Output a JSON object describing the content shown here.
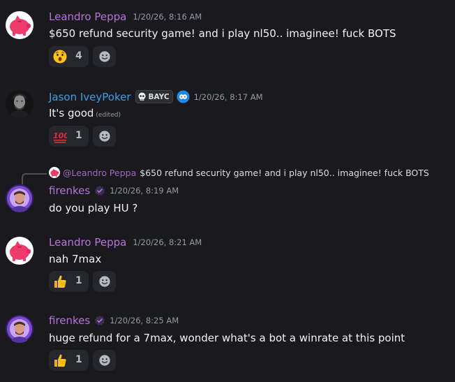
{
  "messages": [
    {
      "author": "Leandro Peppa",
      "timestamp": "1/20/26, 8:16 AM",
      "text": "$650 refund security game! and i play nl50.. imaginee! fuck BOTS",
      "reaction": {
        "emoji": "astonished-face",
        "count": "4"
      }
    },
    {
      "author": "Jason IveyPoker",
      "tag": "BAYC",
      "timestamp": "1/20/26, 8:17 AM",
      "text": "It's good",
      "edited": "(edited)",
      "reaction": {
        "emoji": "hundred-points",
        "count": "1"
      }
    },
    {
      "reply_to": {
        "author": "@Leandro Peppa",
        "text": "$650 refund security game! and i play nl50.. imaginee! fuck BOTS"
      },
      "author": "firenkes",
      "timestamp": "1/20/26, 8:19 AM",
      "text": "do you play HU ?"
    },
    {
      "author": "Leandro Peppa",
      "timestamp": "1/20/26, 8:21 AM",
      "text": "nah 7max",
      "reaction": {
        "emoji": "thumbs-up",
        "count": "1"
      }
    },
    {
      "author": "firenkes",
      "timestamp": "1/20/26, 8:25 AM",
      "text": "huge refund for a 7max, wonder what's a bot a winrate at this point",
      "reaction": {
        "emoji": "thumbs-up",
        "count": "1"
      }
    }
  ],
  "colors": {
    "background": "#1a1a1e",
    "name_purple": "#b674d8",
    "name_blue": "#3e9de6",
    "text": "#f2f3f5",
    "timestamp": "#949ba4"
  }
}
